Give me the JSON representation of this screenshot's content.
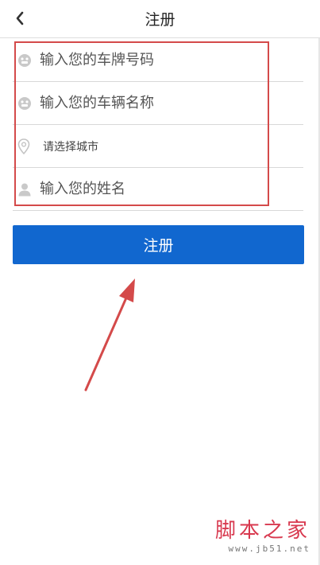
{
  "header": {
    "title": "注册"
  },
  "form": {
    "plate_placeholder": "输入您的车牌号码",
    "vehicle_name_placeholder": "输入您的车辆名称",
    "city_placeholder": "请选择城市",
    "name_placeholder": "输入您的姓名"
  },
  "submit_label": "注册",
  "watermark": {
    "main": "脚本之家",
    "url": "www.jb51.net"
  },
  "icons": {
    "back": "chevron-left-icon",
    "plate": "car-badge-icon",
    "vehicle": "car-badge-icon",
    "city": "location-pin-icon",
    "name": "person-icon"
  },
  "colors": {
    "primary": "#1167cf",
    "annotation": "#d44a4a",
    "watermark": "#d8394f"
  }
}
